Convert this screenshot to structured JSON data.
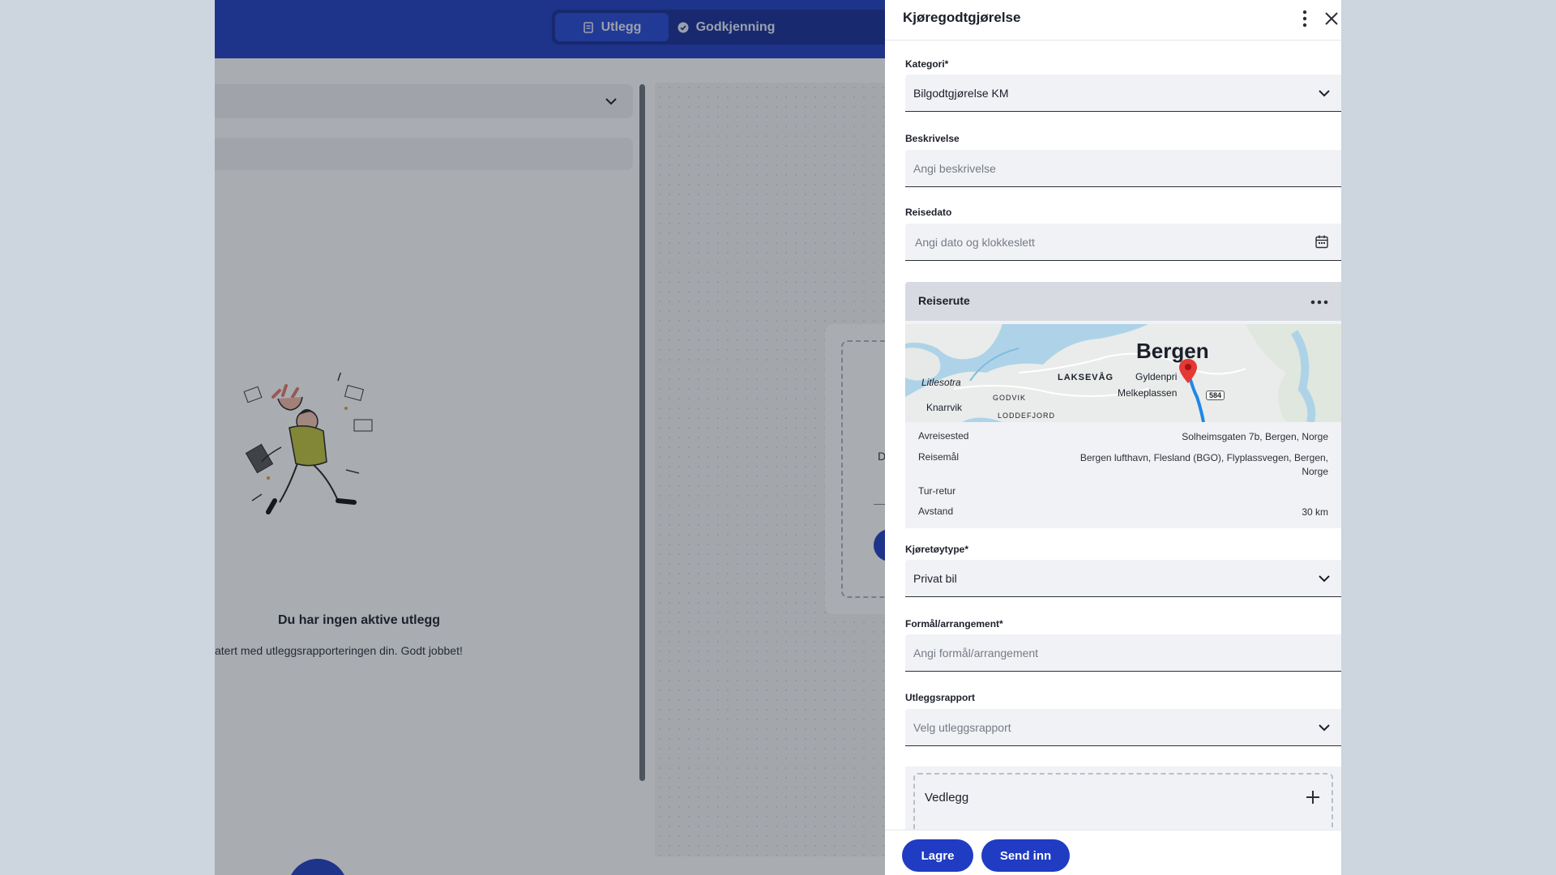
{
  "header": {
    "tabs": [
      {
        "label": "Utlegg",
        "icon": "receipt-icon",
        "active": true
      },
      {
        "label": "Godkjenning",
        "icon": "check-circle-icon",
        "active": false
      }
    ]
  },
  "empty_state": {
    "title": "Du har ingen aktive utlegg",
    "subtitle": "atert med utleggsrapporteringen din. Godt jobbet!"
  },
  "card": {
    "letter": "D"
  },
  "drawer": {
    "title": "Kjøregodtgjørelse",
    "fields": {
      "kategori": {
        "label": "Kategori*",
        "value": "Bilgodtgjørelse KM"
      },
      "beskrivelse": {
        "label": "Beskrivelse",
        "placeholder": "Angi beskrivelse"
      },
      "reisedato": {
        "label": "Reisedato",
        "placeholder": "Angi dato og klokkeslett"
      },
      "kjoretoy": {
        "label": "Kjøretøytype*",
        "value": "Privat bil"
      },
      "formal": {
        "label": "Formål/arrangement*",
        "placeholder": "Angi formål/arrangement"
      },
      "rapport": {
        "label": "Utleggsrapport",
        "placeholder": "Velg utleggsrapport"
      }
    },
    "route": {
      "title": "Reiserute",
      "map_labels": {
        "city": "Bergen",
        "litlesotra": "Litlesotra",
        "laksevag": "LAKSEVÅG",
        "gyldenpris": "Gyldenpri",
        "knarrvik": "Knarrvik",
        "godvik": "GODVIK",
        "melkeplassen": "Melkeplassen",
        "loddefjord": "LODDEFJORD",
        "road": "584"
      },
      "rows": [
        {
          "label": "Avreisested",
          "value": "Solheimsgaten 7b, Bergen, Norge"
        },
        {
          "label": "Reisemål",
          "value": "Bergen lufthavn, Flesland (BGO), Flyplassvegen, Bergen, Norge"
        },
        {
          "label": "Tur-retur",
          "value": ""
        },
        {
          "label": "Avstand",
          "value": "30 km"
        }
      ]
    },
    "attachment": {
      "label": "Vedlegg"
    },
    "footer": {
      "save": "Lagre",
      "submit": "Send inn"
    }
  },
  "colors": {
    "primary": "#1f3cc2",
    "header": "#1f3cc2",
    "field_bg": "#f1f2f5"
  }
}
